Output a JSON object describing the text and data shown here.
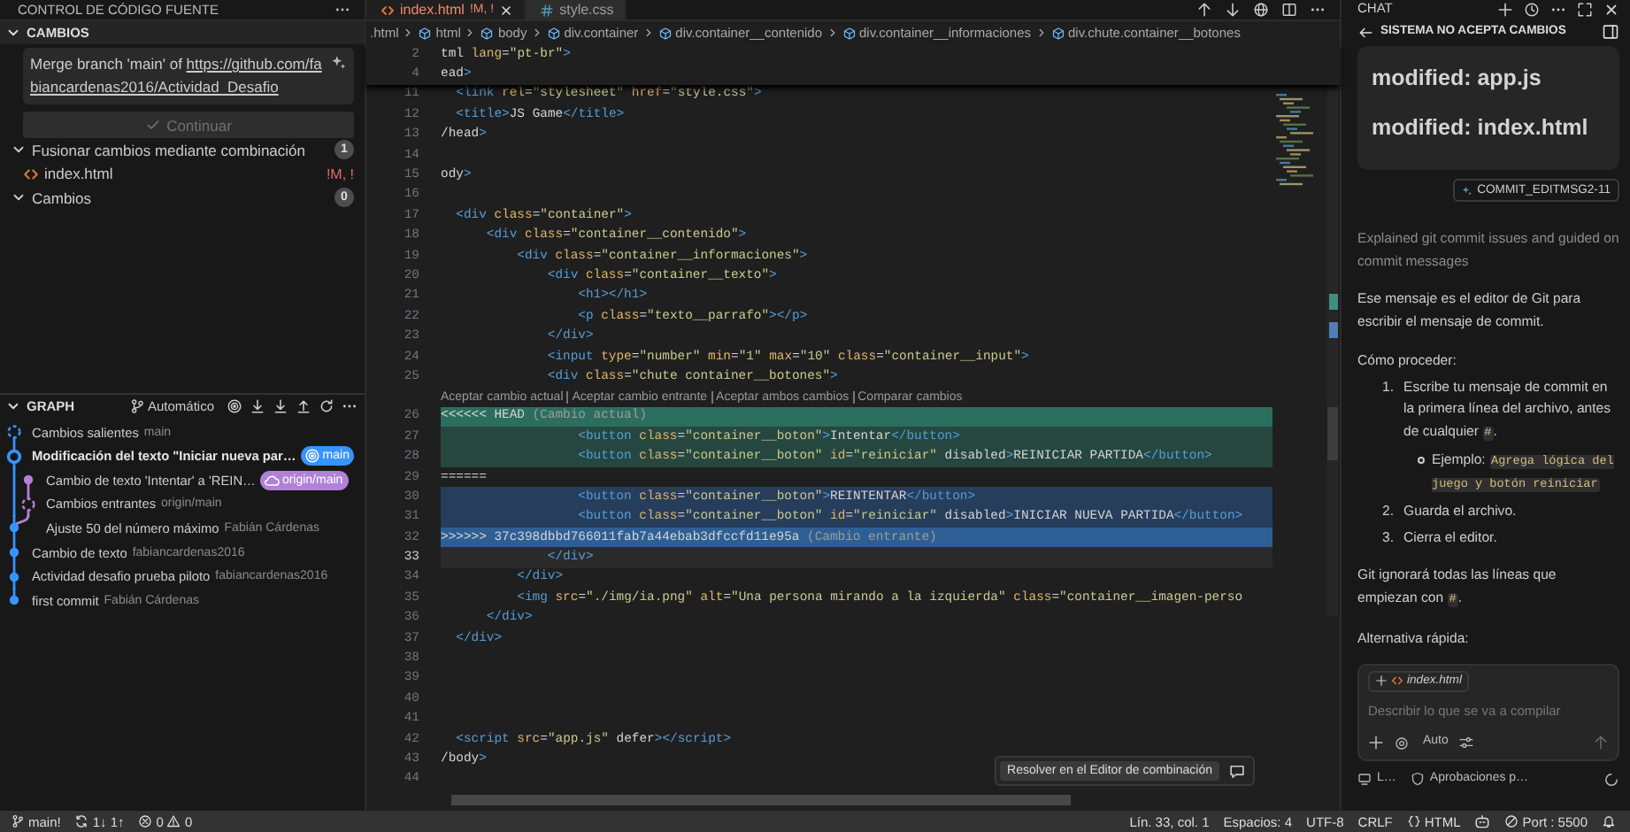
{
  "sidebar": {
    "title": "CONTROL DE CÓDIGO FUENTE",
    "changes": {
      "title": "CAMBIOS",
      "expanded": true,
      "message": [
        {
          "kind": "text",
          "text": "Merge branch 'main' of "
        },
        {
          "kind": "link",
          "text": "https://github.com/fabiancardenas2016/Actividad_Desafio"
        }
      ],
      "continue_button": {
        "label": "Continuar",
        "disabled": true
      },
      "groups": [
        {
          "label": "Fusionar cambios mediante combinación",
          "count": "1",
          "expanded": true,
          "children": [
            {
              "label": "index.html",
              "status": "!M, !"
            }
          ]
        },
        {
          "label": "Cambios",
          "count": "0",
          "expanded": true
        }
      ]
    },
    "graph": {
      "title": "GRAPH",
      "expanded": true,
      "mode": "Automático",
      "items": [
        {
          "kind": "outgoing",
          "on_branch": false,
          "branch_line": false,
          "color": "#3794ff",
          "title": "Cambios salientes",
          "detail": "main"
        },
        {
          "kind": "head",
          "on_branch": false,
          "branch_line": false,
          "color": "#3794ff",
          "title": "Modificación del texto \"Iniciar nueva par…",
          "badges": [
            {
              "kind": "local",
              "label": "main"
            }
          ]
        },
        {
          "kind": "commit",
          "on_branch": true,
          "branch_line": true,
          "color": "#b180d7",
          "title": "Cambio de texto 'Intentar' a 'REIN…",
          "badges": [
            {
              "kind": "remote",
              "label": "origin/main"
            }
          ]
        },
        {
          "kind": "incoming",
          "on_branch": true,
          "branch_line": true,
          "color": "#b180d7",
          "title": "Cambios entrantes",
          "detail": "origin/main"
        },
        {
          "kind": "commit",
          "on_branch": false,
          "branch_line": true,
          "color": "#3794ff",
          "title": "Ajuste 50 del número máximo",
          "detail": "Fabián Cárdenas"
        },
        {
          "kind": "commit",
          "on_branch": false,
          "branch_line": false,
          "color": "#3794ff",
          "title": "Cambio de texto",
          "detail": "fabiancardenas2016"
        },
        {
          "kind": "commit",
          "on_branch": false,
          "branch_line": false,
          "color": "#3794ff",
          "title": "Actividad desafio prueba piloto",
          "detail": "fabiancardenas2016"
        },
        {
          "kind": "commit",
          "on_branch": false,
          "branch_line": false,
          "color": "#3794ff",
          "title": "first commit",
          "detail": "Fabián Cárdenas"
        }
      ]
    }
  },
  "editor": {
    "tabs": [
      {
        "label": "index.html",
        "status": "!M, !",
        "kind": "html",
        "selected": true
      },
      {
        "label": "style.css",
        "kind": "css",
        "selected": false
      }
    ],
    "breadcrumbs": [
      {
        "kind": "file",
        "label": ".html"
      },
      {
        "kind": "element",
        "label": "html"
      },
      {
        "kind": "element",
        "label": "body"
      },
      {
        "kind": "element",
        "label": "div.container"
      },
      {
        "kind": "element",
        "label": "div.container__contenido"
      },
      {
        "kind": "element",
        "label": "div.container__informaciones"
      },
      {
        "kind": "element",
        "label": "div.chute.container__botones"
      }
    ],
    "sticky_lines": [
      {
        "number": "2",
        "kind": "code",
        "text": "tml lang=\"pt-br\">"
      },
      {
        "number": "4",
        "kind": "code",
        "text": "ead>"
      }
    ],
    "lines_before": [
      {
        "number": "11",
        "kind": "code",
        "text": "  <link rel=\"stylesheet\" href=\"style.css\">"
      },
      {
        "number": "12",
        "kind": "code",
        "text": "  <title>JS Game</title>"
      },
      {
        "number": "13",
        "kind": "code",
        "text": "/head>"
      },
      {
        "number": "14",
        "kind": "code"
      },
      {
        "number": "15",
        "kind": "code",
        "text": "ody>"
      },
      {
        "number": "16",
        "kind": "code"
      },
      {
        "number": "17",
        "kind": "code",
        "text": "  <div class=\"container\">"
      },
      {
        "number": "18",
        "kind": "code",
        "text": "      <div class=\"container__contenido\">"
      },
      {
        "number": "19",
        "kind": "code",
        "text": "          <div class=\"container__informaciones\">"
      },
      {
        "number": "20",
        "kind": "code",
        "text": "              <div class=\"container__texto\">"
      },
      {
        "number": "21",
        "kind": "code",
        "text": "                  <h1></h1>"
      },
      {
        "number": "22",
        "kind": "code",
        "text": "                  <p class=\"texto__parrafo\"></p>"
      },
      {
        "number": "23",
        "kind": "code",
        "text": "              </div>"
      },
      {
        "number": "24",
        "kind": "code",
        "text": "              <input type=\"number\" min=\"1\" max=\"10\" class=\"container__input\">"
      },
      {
        "number": "25",
        "kind": "code",
        "text": "              <div class=\"chute container__botones\">"
      }
    ],
    "codelens": [
      "Aceptar cambio actual",
      "Aceptar cambio entrante",
      "Aceptar ambos cambios",
      "Comparar cambios"
    ],
    "lines_after": [
      {
        "number": "26",
        "kind": "current-marker",
        "text": "<<<<<< HEAD ",
        "note": "(Cambio actual)"
      },
      {
        "number": "27",
        "kind": "current",
        "text": "                  <button class=\"container__boton\">Intentar</button>"
      },
      {
        "number": "28",
        "kind": "current",
        "text": "                  <button class=\"container__boton\" id=\"reiniciar\" disabled>REINICIAR PARTIDA</button>"
      },
      {
        "number": "29",
        "kind": "separator",
        "text": "======"
      },
      {
        "number": "30",
        "kind": "incoming",
        "text": "                  <button class=\"container__boton\">REINTENTAR</button>"
      },
      {
        "number": "31",
        "kind": "incoming",
        "text": "                  <button class=\"container__boton\" id=\"reiniciar\" disabled>INICIAR NUEVA PARTIDA</button>"
      },
      {
        "number": "32",
        "kind": "incoming-marker",
        "text": ">>>>>> 37c398dbbd766011fab7a44ebab3dfccfd11e95a ",
        "note": "(Cambio entrante)"
      },
      {
        "number": "33",
        "kind": "active",
        "text": "              </div>"
      },
      {
        "number": "34",
        "kind": "code",
        "text": "          </div>"
      },
      {
        "number": "35",
        "kind": "code",
        "text": "          <img src=\"./img/ia.png\" alt=\"Una persona mirando a la izquierda\" class=\"container__imagen-perso"
      },
      {
        "number": "36",
        "kind": "code",
        "text": "      </div>"
      },
      {
        "number": "37",
        "kind": "code",
        "text": "  </div>"
      },
      {
        "number": "38",
        "kind": "code"
      },
      {
        "number": "39",
        "kind": "code"
      },
      {
        "number": "40",
        "kind": "code"
      },
      {
        "number": "41",
        "kind": "code"
      },
      {
        "number": "42",
        "kind": "code",
        "text": "  <script src=\"app.js\" defer></script>"
      },
      {
        "number": "43",
        "kind": "code",
        "text": "/body>"
      },
      {
        "number": "44",
        "kind": "code"
      }
    ],
    "hover_button": "Resolver en el Editor de combinación"
  },
  "chat": {
    "title": "CHAT",
    "session_title": "SISTEMA NO ACEPTA CAMBIOS",
    "card_lines": [
      "modified: app.js",
      "modified: index.html"
    ],
    "reference": "COMMIT_EDITMSG2-11",
    "summary": "Explained git commit issues and guided on commit messages",
    "blocks": [
      {
        "kind": "paragraph",
        "parts": [
          {
            "kind": "text",
            "text": "Ese mensaje es el editor de Git para escribir el mensaje de commit."
          }
        ]
      },
      {
        "kind": "paragraph",
        "parts": [
          {
            "kind": "text",
            "text": "Cómo proceder:"
          }
        ]
      },
      {
        "kind": "list",
        "items": [
          {
            "number": "1.",
            "parts": [
              {
                "kind": "text",
                "text": "Escribe tu mensaje de commit en la primera línea del archivo, antes de cualquier "
              },
              {
                "kind": "code",
                "text": "#"
              },
              {
                "kind": "text",
                "text": "."
              }
            ],
            "children": [
              {
                "parts": [
                  {
                    "kind": "text",
                    "text": "Ejemplo: "
                  },
                  {
                    "kind": "code",
                    "text": "Agrega lógica del juego y botón reiniciar"
                  }
                ]
              }
            ]
          },
          {
            "number": "2.",
            "parts": [
              {
                "kind": "text",
                "text": "Guarda el archivo."
              }
            ]
          },
          {
            "number": "3.",
            "parts": [
              {
                "kind": "text",
                "text": "Cierra el editor."
              }
            ]
          }
        ]
      },
      {
        "kind": "paragraph",
        "parts": [
          {
            "kind": "text",
            "text": "Git ignorará todas las líneas que empiezan con "
          },
          {
            "kind": "code",
            "text": "#"
          },
          {
            "kind": "text",
            "text": "."
          }
        ]
      },
      {
        "kind": "paragraph",
        "parts": [
          {
            "kind": "text",
            "text": "Alternativa rápida:"
          }
        ]
      }
    ],
    "input": {
      "attachment": "index.html",
      "placeholder": "Describir lo que se va a compilar",
      "mode": "Auto"
    },
    "footer": [
      {
        "kind": "device",
        "label": "L…"
      },
      {
        "kind": "approvals",
        "label": "Aprobaciones p…"
      }
    ]
  },
  "status_bar": {
    "left": [
      {
        "kind": "branch",
        "label": "main!"
      },
      {
        "kind": "sync",
        "label": "1↓ 1↑"
      },
      {
        "kind": "problems",
        "errors": "0",
        "warnings": "0"
      }
    ],
    "right": [
      {
        "kind": "plain",
        "label": "Lín. 33, col. 1"
      },
      {
        "kind": "plain",
        "label": "Espacios: 4"
      },
      {
        "kind": "plain",
        "label": "UTF-8"
      },
      {
        "kind": "plain",
        "label": "CRLF"
      },
      {
        "kind": "language",
        "label": "HTML"
      },
      {
        "kind": "port",
        "label": "Port : 5500"
      }
    ]
  }
}
